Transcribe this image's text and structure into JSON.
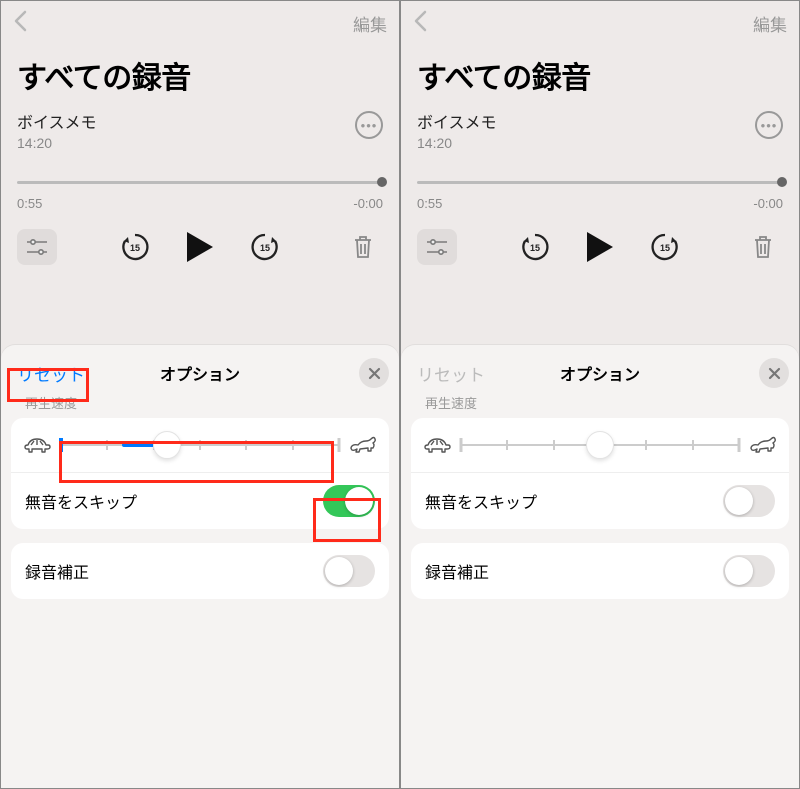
{
  "shared": {
    "edit_label": "編集",
    "page_title": "すべての録音",
    "memo_name": "ボイスメモ",
    "memo_time": "14:20",
    "elapsed": "0:55",
    "remaining": "-0:00",
    "skip_seconds": "15",
    "sheet_title": "オプション",
    "section_speed": "再生速度",
    "skip_silence_label": "無音をスキップ",
    "enhance_label": "録音補正",
    "reset_label": "リセット"
  },
  "left": {
    "reset_enabled": true,
    "speed_percent": 38,
    "speed_fill_start": 22,
    "tick_end_blue": true,
    "skip_silence_on": true,
    "enhance_on": false
  },
  "right": {
    "reset_enabled": false,
    "speed_percent": 50,
    "skip_silence_on": false,
    "enhance_on": false
  }
}
